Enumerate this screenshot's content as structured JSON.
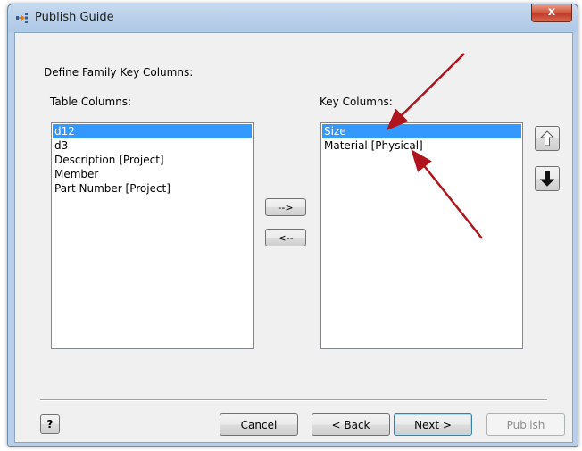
{
  "window": {
    "title": "Publish Guide",
    "close_label": "x"
  },
  "heading": "Define Family Key Columns:",
  "table_columns": {
    "label": "Table Columns:",
    "items": [
      "d12",
      "d3",
      "Description [Project]",
      "Member",
      "Part Number [Project]"
    ],
    "selected": "d12"
  },
  "key_columns": {
    "label": "Key Columns:",
    "items": [
      "Size",
      "Material [Physical]"
    ],
    "selected": "Size"
  },
  "transfer": {
    "add_label": "-->",
    "remove_label": "<--"
  },
  "reorder": {
    "up_icon": "arrow-up-icon",
    "down_icon": "arrow-down-icon"
  },
  "footer": {
    "help_label": "?",
    "cancel_label": "Cancel",
    "back_label": "< Back",
    "next_label": "Next >",
    "publish_label": "Publish"
  },
  "colors": {
    "selection": "#3399ff",
    "annotation_arrow": "#b0141c"
  }
}
